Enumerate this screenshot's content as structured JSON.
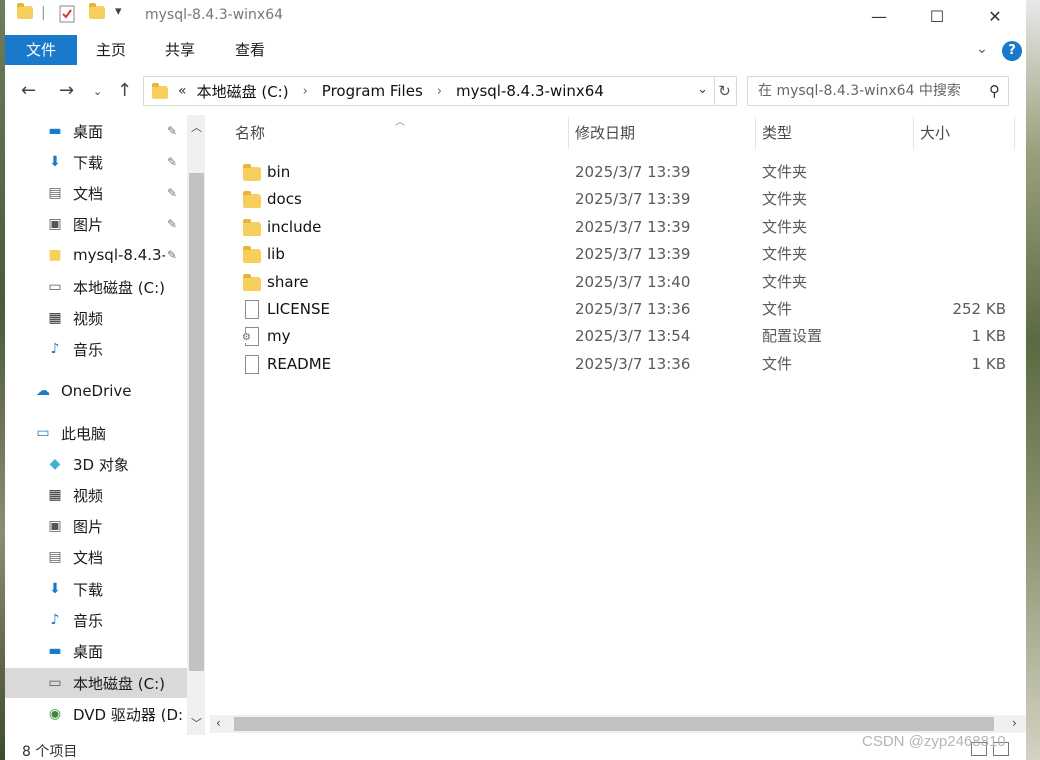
{
  "window": {
    "title": "mysql-8.4.3-winx64",
    "minimize": "—",
    "maximize": "☐",
    "close": "✕"
  },
  "ribbon": {
    "tabs": [
      "文件",
      "主页",
      "共享",
      "查看"
    ],
    "help": "?",
    "expand": "⌄"
  },
  "address": {
    "overflow": "«",
    "crumbs": [
      "本地磁盘 (C:)",
      "Program Files",
      "mysql-8.4.3-winx64"
    ],
    "search_placeholder": "在 mysql-8.4.3-winx64 中搜索"
  },
  "sidebar": {
    "items": [
      {
        "label": "桌面",
        "icon": "desktop-icon",
        "pinned": true
      },
      {
        "label": "下载",
        "icon": "download-icon",
        "pinned": true
      },
      {
        "label": "文档",
        "icon": "documents-icon",
        "pinned": true
      },
      {
        "label": "图片",
        "icon": "pictures-icon",
        "pinned": true
      },
      {
        "label": "mysql-8.4.3-",
        "icon": "folder-icon",
        "pinned": true
      },
      {
        "label": "本地磁盘 (C:)",
        "icon": "drive-icon"
      },
      {
        "label": "视频",
        "icon": "videos-icon"
      },
      {
        "label": "音乐",
        "icon": "music-icon"
      },
      {
        "label": "OneDrive",
        "icon": "onedrive-icon"
      },
      {
        "label": "此电脑",
        "icon": "this-pc-icon"
      },
      {
        "label": "3D 对象",
        "icon": "3d-objects-icon"
      },
      {
        "label": "视频",
        "icon": "videos-icon"
      },
      {
        "label": "图片",
        "icon": "pictures-icon"
      },
      {
        "label": "文档",
        "icon": "documents-icon"
      },
      {
        "label": "下载",
        "icon": "download-icon"
      },
      {
        "label": "音乐",
        "icon": "music-icon"
      },
      {
        "label": "桌面",
        "icon": "desktop-icon"
      },
      {
        "label": "本地磁盘 (C:)",
        "icon": "drive-icon",
        "selected": true
      },
      {
        "label": "DVD 驱动器 (D:",
        "icon": "dvd-drive-icon"
      }
    ]
  },
  "columns": {
    "name": "名称",
    "date": "修改日期",
    "type": "类型",
    "size": "大小"
  },
  "files": [
    {
      "name": "bin",
      "date": "2025/3/7 13:39",
      "type": "文件夹",
      "size": "",
      "kind": "folder"
    },
    {
      "name": "docs",
      "date": "2025/3/7 13:39",
      "type": "文件夹",
      "size": "",
      "kind": "folder"
    },
    {
      "name": "include",
      "date": "2025/3/7 13:39",
      "type": "文件夹",
      "size": "",
      "kind": "folder"
    },
    {
      "name": "lib",
      "date": "2025/3/7 13:39",
      "type": "文件夹",
      "size": "",
      "kind": "folder"
    },
    {
      "name": "share",
      "date": "2025/3/7 13:40",
      "type": "文件夹",
      "size": "",
      "kind": "folder"
    },
    {
      "name": "LICENSE",
      "date": "2025/3/7 13:36",
      "type": "文件",
      "size": "252 KB",
      "kind": "file"
    },
    {
      "name": "my",
      "date": "2025/3/7 13:54",
      "type": "配置设置",
      "size": "1 KB",
      "kind": "config"
    },
    {
      "name": "README",
      "date": "2025/3/7 13:36",
      "type": "文件",
      "size": "1 KB",
      "kind": "file"
    }
  ],
  "status": {
    "count": "8 个项目"
  },
  "watermark": "CSDN @zyp2468810"
}
